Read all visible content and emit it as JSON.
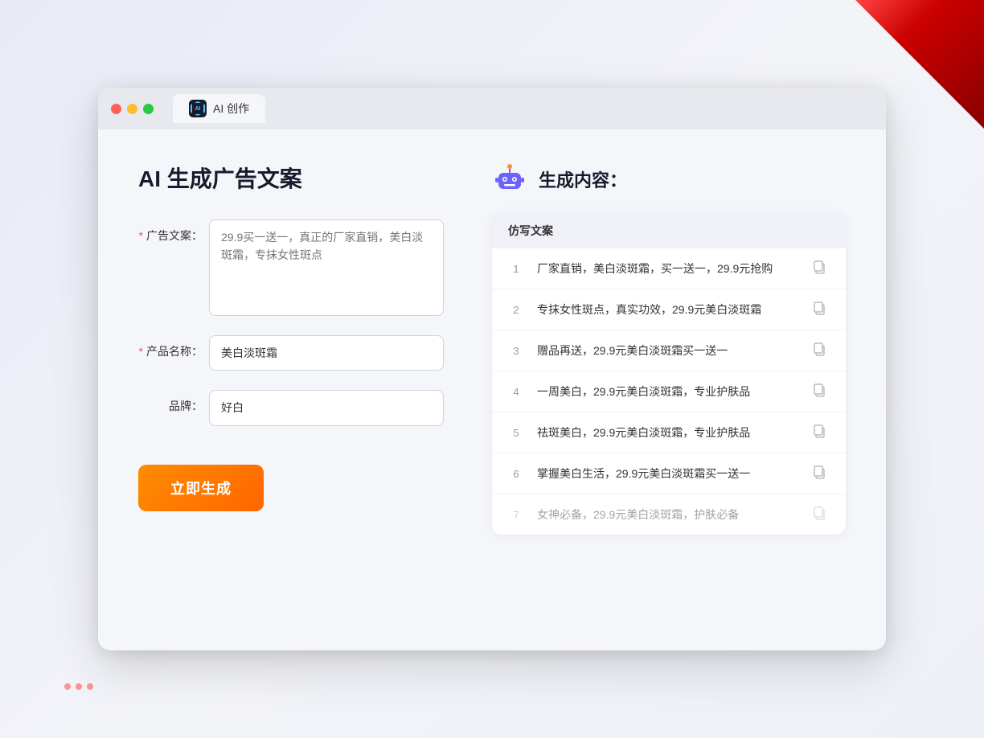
{
  "window": {
    "tab_label": "AI 创作"
  },
  "header": {
    "title": "AI 生成广告文案"
  },
  "form": {
    "ad_label": "广告文案：",
    "ad_required": "*",
    "ad_placeholder": "29.9买一送一，真正的厂家直销，美白淡斑霜，专抹女性斑点",
    "product_label": "产品名称：",
    "product_required": "*",
    "product_value": "美白淡斑霜",
    "brand_label": "品牌：",
    "brand_value": "好白",
    "generate_btn": "立即生成"
  },
  "result": {
    "title": "生成内容：",
    "column_header": "仿写文案",
    "items": [
      {
        "num": "1",
        "text": "厂家直销，美白淡斑霜，买一送一，29.9元抢购",
        "faded": false
      },
      {
        "num": "2",
        "text": "专抹女性斑点，真实功效，29.9元美白淡斑霜",
        "faded": false
      },
      {
        "num": "3",
        "text": "赠品再送，29.9元美白淡斑霜买一送一",
        "faded": false
      },
      {
        "num": "4",
        "text": "一周美白，29.9元美白淡斑霜，专业护肤品",
        "faded": false
      },
      {
        "num": "5",
        "text": "祛斑美白，29.9元美白淡斑霜，专业护肤品",
        "faded": false
      },
      {
        "num": "6",
        "text": "掌握美白生活，29.9元美白淡斑霜买一送一",
        "faded": false
      },
      {
        "num": "7",
        "text": "女神必备，29.9元美白淡斑霜，护肤必备",
        "faded": true
      }
    ]
  }
}
